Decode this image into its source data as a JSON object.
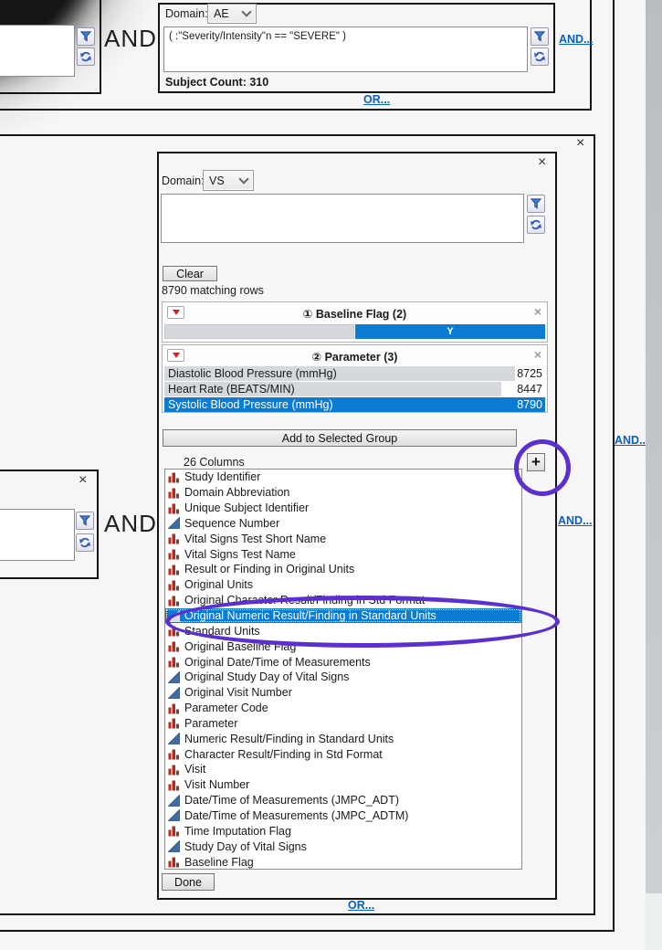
{
  "icons": {
    "close_glyph": "×",
    "plus_label": "+"
  },
  "colors": {
    "selection_blue": "#0b7bd3",
    "bar_gray": "#d5d8dd",
    "annotation_purple": "#5b2fd0",
    "link_blue": "#0a60c2",
    "nominal_icon_red": "#b5291c",
    "continuous_icon_blue": "#3f6da3"
  },
  "top_group": {
    "and_label": "AND",
    "and_link": "AND...",
    "or_link": "OR...",
    "condition": {
      "domain_label": "Domain:",
      "domain_value": "AE",
      "expression": "( :\"Severity/Intensity\"n == \"SEVERE\" )",
      "subject_count": "Subject Count: 310"
    }
  },
  "main_group": {
    "and_label": "AND",
    "and_link": "AND...",
    "or_link": "OR...",
    "dialog": {
      "domain_label": "Domain:",
      "domain_value": "VS",
      "expression": "",
      "clear_button": "Clear",
      "matching_rows": "8790 matching rows",
      "baseline_panel": {
        "title": "① Baseline Flag (2)",
        "segments": [
          {
            "label": "",
            "width_pct": 50,
            "type": "gray"
          },
          {
            "label": "Y",
            "width_pct": 50,
            "type": "blue"
          }
        ]
      },
      "parameter_panel": {
        "title": "② Parameter (3)",
        "rows": [
          {
            "label": "Diastolic Blood Pressure (mmHg)",
            "count": "8725",
            "width_pct": 92,
            "type": "gray"
          },
          {
            "label": "Heart Rate (BEATS/MIN)",
            "count": "8447",
            "width_pct": 88.5,
            "type": "gray"
          },
          {
            "label": "Systolic Blood Pressure (mmHg)",
            "count": "8790",
            "width_pct": 100,
            "type": "blue",
            "selected": true
          }
        ]
      },
      "add_to_group_button": "Add to Selected Group",
      "columns": {
        "header": "26 Columns",
        "items": [
          {
            "label": "Study Identifier",
            "type": "nominal"
          },
          {
            "label": "Domain Abbreviation",
            "type": "nominal"
          },
          {
            "label": "Unique Subject Identifier",
            "type": "nominal"
          },
          {
            "label": "Sequence Number",
            "type": "continuous"
          },
          {
            "label": "Vital Signs Test Short Name",
            "type": "nominal"
          },
          {
            "label": "Vital Signs Test Name",
            "type": "nominal"
          },
          {
            "label": "Result or Finding in Original Units",
            "type": "nominal"
          },
          {
            "label": "Original Units",
            "type": "nominal"
          },
          {
            "label": "Original Character Result/Finding in Std Format",
            "type": "nominal"
          },
          {
            "label": "Original Numeric Result/Finding in Standard Units",
            "type": "continuous",
            "selected": true
          },
          {
            "label": "Standard Units",
            "type": "nominal"
          },
          {
            "label": "Original Baseline Flag",
            "type": "nominal"
          },
          {
            "label": "Original Date/Time of Measurements",
            "type": "nominal"
          },
          {
            "label": "Original Study Day of Vital Signs",
            "type": "continuous"
          },
          {
            "label": "Original Visit Number",
            "type": "continuous"
          },
          {
            "label": "Parameter Code",
            "type": "nominal"
          },
          {
            "label": "Parameter",
            "type": "nominal"
          },
          {
            "label": "Numeric Result/Finding in Standard Units",
            "type": "continuous"
          },
          {
            "label": "Character Result/Finding in Std Format",
            "type": "nominal"
          },
          {
            "label": "Visit",
            "type": "nominal"
          },
          {
            "label": "Visit Number",
            "type": "nominal"
          },
          {
            "label": "Date/Time of Measurements (JMPC_ADT)",
            "type": "continuous"
          },
          {
            "label": "Date/Time of Measurements (JMPC_ADTM)",
            "type": "continuous"
          },
          {
            "label": "Time Imputation Flag",
            "type": "nominal"
          },
          {
            "label": "Study Day of Vital Signs",
            "type": "continuous"
          },
          {
            "label": "Baseline Flag",
            "type": "nominal"
          }
        ]
      },
      "done_button": "Done"
    }
  },
  "outer": {
    "and_link": "AND..."
  }
}
